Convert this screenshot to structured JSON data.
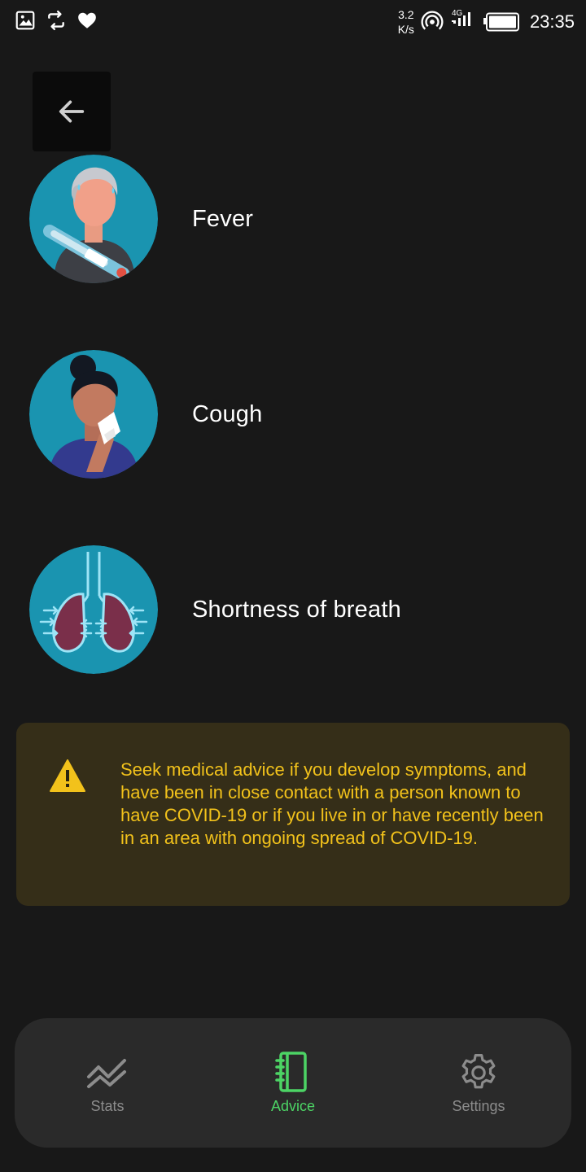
{
  "status_bar": {
    "net_speed_value": "3.2",
    "net_speed_unit": "K/s",
    "network_type": "4G",
    "time": "23:35",
    "icons_left": [
      "gallery-icon",
      "sync-icon",
      "heart-icon"
    ],
    "icons_right": [
      "hotspot-icon",
      "signal-icon",
      "battery-icon"
    ]
  },
  "header": {
    "back_icon": "arrow-left-icon"
  },
  "symptoms": [
    {
      "label": "Fever",
      "icon": "fever-illustration"
    },
    {
      "label": "Cough",
      "icon": "cough-illustration"
    },
    {
      "label": "Shortness of breath",
      "icon": "lungs-illustration"
    }
  ],
  "warning": {
    "icon": "warning-triangle-icon",
    "text": "Seek medical advice if you develop symptoms, and have been in close contact with a person known to have COVID-19 or if you live in or have recently been in an area with ongoing spread of COVID-19.",
    "accent_color": "#f2c21b",
    "background_color": "#352e18"
  },
  "bottom_nav": {
    "items": [
      {
        "label": "Stats",
        "icon": "stats-icon",
        "active": false
      },
      {
        "label": "Advice",
        "icon": "advice-notebook-icon",
        "active": true
      },
      {
        "label": "Settings",
        "icon": "gear-icon",
        "active": false
      }
    ],
    "active_color": "#4cd465",
    "inactive_color": "#8c8c8c"
  }
}
